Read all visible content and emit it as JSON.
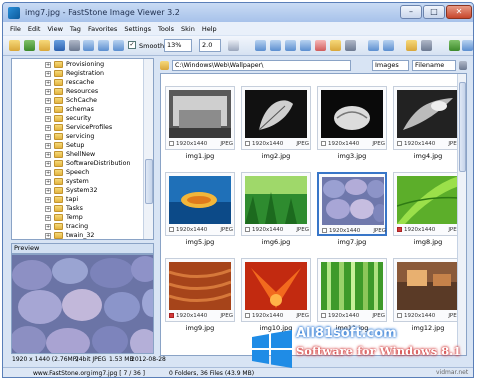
{
  "window": {
    "title": "img7.jpg - FastStone Image Viewer 3.2",
    "controls": {
      "minimize": "–",
      "maximize": "□",
      "close": "✕"
    }
  },
  "menu": [
    "File",
    "Edit",
    "View",
    "Tag",
    "Favorites",
    "Settings",
    "Tools",
    "Skin",
    "Help"
  ],
  "toolbar": {
    "smooth_label": "Smooth",
    "smooth_checked": "✓",
    "zoom_value": "13%",
    "ratio_value": "2.0"
  },
  "tree": {
    "items": [
      "Provisioning",
      "Registration",
      "rescache",
      "Resources",
      "SchCache",
      "schemas",
      "security",
      "ServiceProfiles",
      "servicing",
      "Setup",
      "ShellNew",
      "SoftwareDistribution",
      "Speech",
      "system",
      "System32",
      "tapi",
      "Tasks",
      "Temp",
      "tracing",
      "twain_32"
    ]
  },
  "preview": {
    "title": "Preview",
    "info": {
      "dimensions": "1920 x 1440 (2.76MP)",
      "bitdepth": "24bit JPEG",
      "filesize": "1.53 MB",
      "date": "2012-08-28"
    }
  },
  "browser": {
    "path": "C:\\Windows\\Web\\Wallpaper\\",
    "filter": "Images",
    "sort": "Filename",
    "thumbs": [
      {
        "name": "img1.jpg",
        "dims": "1920x1440",
        "fmt": "JPEG"
      },
      {
        "name": "img2.jpg",
        "dims": "1920x1440",
        "fmt": "JPEG"
      },
      {
        "name": "img3.jpg",
        "dims": "1920x1440",
        "fmt": "JPEG"
      },
      {
        "name": "img4.jpg",
        "dims": "1920x1440",
        "fmt": "JPEG"
      },
      {
        "name": "img5.jpg",
        "dims": "1920x1440",
        "fmt": "JPEG"
      },
      {
        "name": "img6.jpg",
        "dims": "1920x1440",
        "fmt": "JPEG"
      },
      {
        "name": "img7.jpg",
        "dims": "1920x1440",
        "fmt": "JPEG"
      },
      {
        "name": "img8.jpg",
        "dims": "1920x1440",
        "fmt": "JPEG"
      },
      {
        "name": "img9.jpg",
        "dims": "1920x1440",
        "fmt": "JPEG"
      },
      {
        "name": "img10.jpg",
        "dims": "1920x1440",
        "fmt": "JPEG"
      },
      {
        "name": "img11.jpg",
        "dims": "1920x1440",
        "fmt": "JPEG"
      },
      {
        "name": "img12.jpg",
        "dims": "1920x1440",
        "fmt": "JPEG"
      }
    ]
  },
  "status": {
    "website": "www.FastStone.org",
    "current_file": "img7.jpg [ 7 / 36 ]",
    "folder_info": "0 Folders, 36 Files (43.9 MB)"
  },
  "watermark": {
    "site": "All81soft.com",
    "tagline": "Software for Windows 8.1",
    "credit": "vidmar.net"
  }
}
